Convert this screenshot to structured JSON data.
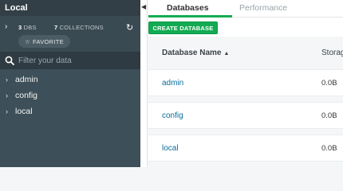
{
  "sidebar": {
    "title": "Local",
    "stats": {
      "dbs_count": "3",
      "dbs_label": "DBS",
      "collections_count": "7",
      "collections_label": "COLLECTIONS"
    },
    "favorite_label": "FAVORITE",
    "filter_placeholder": "Filter your data",
    "databases": [
      {
        "label": "admin"
      },
      {
        "label": "config"
      },
      {
        "label": "local"
      }
    ]
  },
  "tabs": [
    {
      "label": "Databases",
      "active": true
    },
    {
      "label": "Performance",
      "active": false
    }
  ],
  "toolbar": {
    "create_database_label": "CREATE DATABASE"
  },
  "table": {
    "columns": {
      "name": "Database Name",
      "storage": "Storag"
    },
    "rows": [
      {
        "name": "admin",
        "storage_size": "0.0B"
      },
      {
        "name": "config",
        "storage_size": "0.0B"
      },
      {
        "name": "local",
        "storage_size": "0.0B"
      }
    ]
  },
  "colors": {
    "sidebar_bg": "#3d4f58",
    "accent_green": "#13aa52",
    "link_blue": "#0a6e9e"
  },
  "icons": {
    "refresh": "refresh-icon",
    "star": "star-icon",
    "search": "search-icon",
    "chevron": "chevron-right-icon",
    "sort": "sort-asc-icon",
    "collapse": "chevron-left-icon"
  }
}
